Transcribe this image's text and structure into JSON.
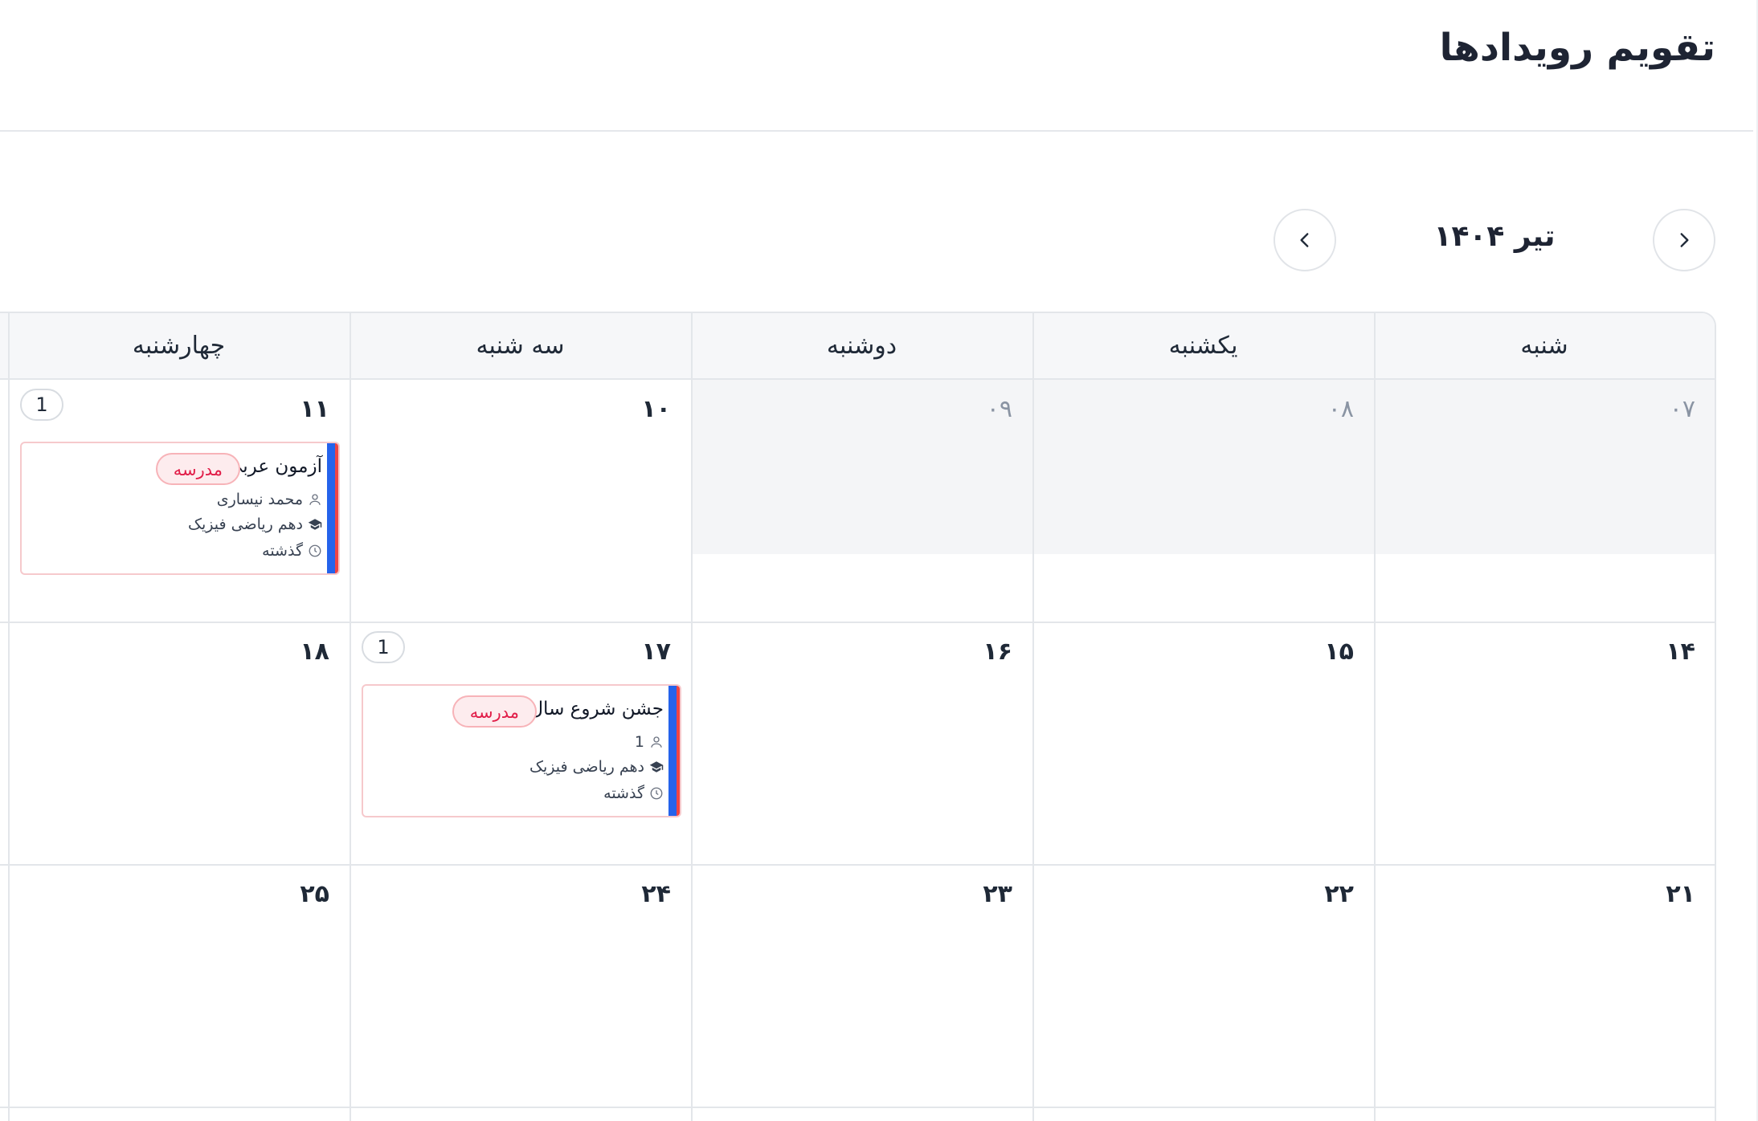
{
  "page": {
    "title": "تقویم رویدادها"
  },
  "nav": {
    "month_label": "۱۴۰۴ تیر",
    "prev_icon": "chevron-right-icon",
    "next_icon": "chevron-left-icon"
  },
  "calendar": {
    "weekdays": [
      "شنبه",
      "یکشنبه",
      "دوشنبه",
      "سه شنبه",
      "چهارشنبه"
    ],
    "weeks": [
      {
        "days": [
          "۰۷",
          "۰۸",
          "۰۹",
          "۱۰",
          "۱۱"
        ]
      },
      {
        "days": [
          "۱۴",
          "۱۵",
          "۱۶",
          "۱۷",
          "۱۸"
        ]
      },
      {
        "days": [
          "۲۱",
          "۲۲",
          "۲۳",
          "۲۴",
          "۲۵"
        ]
      }
    ],
    "badges": {
      "d11": "1",
      "d17": "1"
    }
  },
  "events": [
    {
      "title": "آزمون عربی",
      "tag": "مدرسه",
      "person": "محمد نیساری",
      "class_name": "دهم ریاضی فیزیک",
      "status": "گذشته"
    },
    {
      "title": "جشن شروع سال",
      "tag": "مدرسه",
      "person": "1",
      "class_name": "دهم ریاضی فیزیک",
      "status": "گذشته"
    }
  ],
  "colors": {
    "accent_blue": "#2563eb",
    "accent_red": "#ef4444",
    "tag_text": "#e11d48",
    "tag_bg": "#fdecee",
    "past_day_bg": "#f4f5f7",
    "header_bg": "#f6f7f9"
  }
}
